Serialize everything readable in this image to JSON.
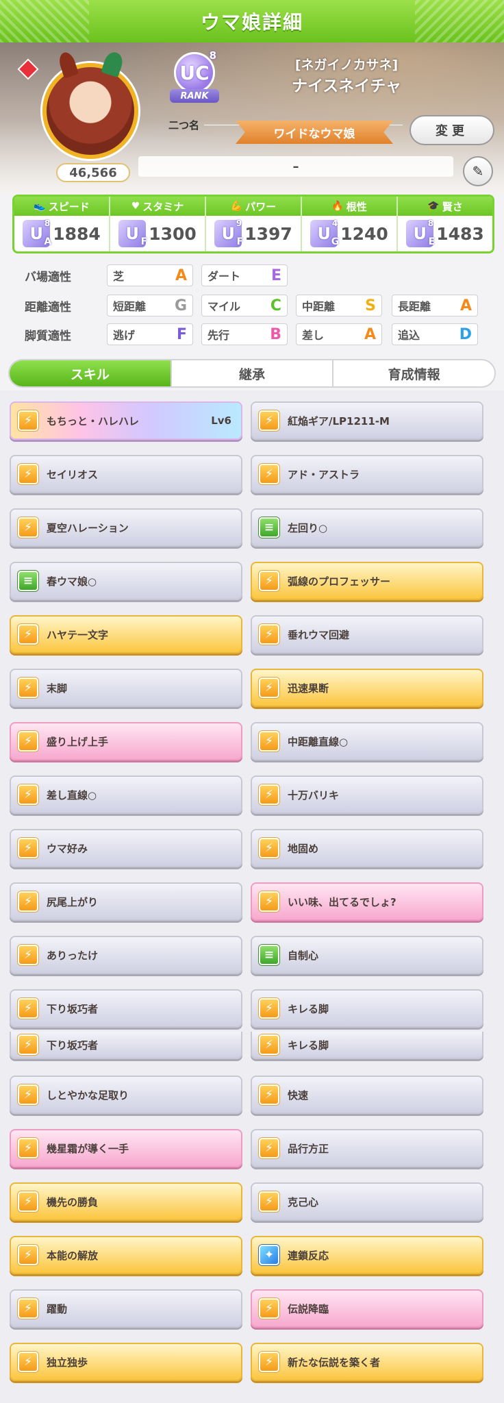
{
  "header": {
    "title": "ウマ娘詳細"
  },
  "profile": {
    "fans": "46,566",
    "rank": {
      "letter": "UC",
      "level": "8",
      "label": "RANK"
    },
    "nickname_label": "二つ名",
    "epithet": "[ネガイノカサネ]",
    "name": "ナイスネイチャ",
    "title_ribbon": "ワイドなウマ娘",
    "change_label": "変更",
    "memo": "–"
  },
  "stats": [
    {
      "label": "スピード",
      "icon": "shoe-icon",
      "grade": "U",
      "grade_sub": "A",
      "grade_sup": "8",
      "value": "1884"
    },
    {
      "label": "スタミナ",
      "icon": "heart-icon",
      "grade": "U",
      "grade_sub": "F",
      "grade_sup": "",
      "value": "1300"
    },
    {
      "label": "パワー",
      "icon": "muscle-icon",
      "grade": "U",
      "grade_sub": "F",
      "grade_sup": "9",
      "value": "1397"
    },
    {
      "label": "根性",
      "icon": "flame-icon",
      "grade": "U",
      "grade_sub": "G",
      "grade_sup": "4",
      "value": "1240"
    },
    {
      "label": "賢さ",
      "icon": "graduation-cap-icon",
      "grade": "U",
      "grade_sub": "E",
      "grade_sup": "8",
      "value": "1483"
    }
  ],
  "aptitudes": {
    "track": {
      "label": "バ場適性",
      "items": [
        {
          "name": "芝",
          "grade": "A"
        },
        {
          "name": "ダート",
          "grade": "E"
        }
      ]
    },
    "distance": {
      "label": "距離適性",
      "items": [
        {
          "name": "短距離",
          "grade": "G"
        },
        {
          "name": "マイル",
          "grade": "C"
        },
        {
          "name": "中距離",
          "grade": "S"
        },
        {
          "name": "長距離",
          "grade": "A"
        }
      ]
    },
    "style": {
      "label": "脚質適性",
      "items": [
        {
          "name": "逃げ",
          "grade": "F"
        },
        {
          "name": "先行",
          "grade": "B"
        },
        {
          "name": "差し",
          "grade": "A"
        },
        {
          "name": "追込",
          "grade": "D"
        }
      ]
    }
  },
  "grade_colors": {
    "A": "#f28a1c",
    "B": "#ec5aa8",
    "C": "#5ac12a",
    "D": "#2ea0e8",
    "E": "#a869e0",
    "F": "#7c5cd6",
    "G": "#9a9a9a",
    "S": "#f0b010"
  },
  "tabs": [
    "スキル",
    "継承",
    "育成情報"
  ],
  "skills": [
    {
      "name": "もちっと・ハレハレ",
      "lv": "Lv6",
      "style": "rainbow",
      "icon": "orange"
    },
    {
      "name": "紅焔ギア/LP1211-M",
      "lv": "",
      "style": "silver",
      "icon": "orange"
    },
    {
      "name": "セイリオス",
      "lv": "",
      "style": "silver",
      "icon": "orange"
    },
    {
      "name": "アド・アストラ",
      "lv": "",
      "style": "silver",
      "icon": "orange"
    },
    {
      "name": "夏空ハレーション",
      "lv": "",
      "style": "silver",
      "icon": "orange"
    },
    {
      "name": "左回り○",
      "lv": "",
      "style": "silver",
      "icon": "green"
    },
    {
      "name": "春ウマ娘○",
      "lv": "",
      "style": "silver",
      "icon": "green"
    },
    {
      "name": "弧線のプロフェッサー",
      "lv": "",
      "style": "gold",
      "icon": "orange"
    },
    {
      "name": "ハヤテ一文字",
      "lv": "",
      "style": "gold",
      "icon": "orange"
    },
    {
      "name": "垂れウマ回避",
      "lv": "",
      "style": "silver",
      "icon": "orange"
    },
    {
      "name": "末脚",
      "lv": "",
      "style": "silver",
      "icon": "orange"
    },
    {
      "name": "迅速果断",
      "lv": "",
      "style": "gold",
      "icon": "orange"
    },
    {
      "name": "盛り上げ上手",
      "lv": "",
      "style": "pink",
      "icon": "orange"
    },
    {
      "name": "中距離直線○",
      "lv": "",
      "style": "silver",
      "icon": "orange"
    },
    {
      "name": "差し直線○",
      "lv": "",
      "style": "silver",
      "icon": "orange"
    },
    {
      "name": "十万バリキ",
      "lv": "",
      "style": "silver",
      "icon": "orange"
    },
    {
      "name": "ウマ好み",
      "lv": "",
      "style": "silver",
      "icon": "orange"
    },
    {
      "name": "地固め",
      "lv": "",
      "style": "silver",
      "icon": "orange"
    },
    {
      "name": "尻尾上がり",
      "lv": "",
      "style": "silver",
      "icon": "orange"
    },
    {
      "name": "いい味、出てるでしょ?",
      "lv": "",
      "style": "pink",
      "icon": "orange"
    },
    {
      "name": "ありったけ",
      "lv": "",
      "style": "silver",
      "icon": "orange"
    },
    {
      "name": "自制心",
      "lv": "",
      "style": "silver",
      "icon": "green"
    },
    {
      "name": "下り坂巧者",
      "lv": "",
      "style": "silver",
      "icon": "orange"
    },
    {
      "name": "キレる脚",
      "lv": "",
      "style": "silver",
      "icon": "orange"
    },
    {
      "name": "下り坂巧者",
      "lv": "",
      "style": "silver",
      "icon": "orange",
      "cut": true
    },
    {
      "name": "キレる脚",
      "lv": "",
      "style": "silver",
      "icon": "orange",
      "cut": true
    },
    {
      "name": "しとやかな足取り",
      "lv": "",
      "style": "silver",
      "icon": "orange"
    },
    {
      "name": "快速",
      "lv": "",
      "style": "silver",
      "icon": "orange"
    },
    {
      "name": "幾星霜が導く一手",
      "lv": "",
      "style": "pink",
      "icon": "orange"
    },
    {
      "name": "品行方正",
      "lv": "",
      "style": "silver",
      "icon": "orange"
    },
    {
      "name": "機先の勝負",
      "lv": "",
      "style": "gold",
      "icon": "orange"
    },
    {
      "name": "克己心",
      "lv": "",
      "style": "silver",
      "icon": "orange"
    },
    {
      "name": "本能の解放",
      "lv": "",
      "style": "gold",
      "icon": "orange"
    },
    {
      "name": "連鎖反応",
      "lv": "",
      "style": "gold",
      "icon": "blue"
    },
    {
      "name": "躍動",
      "lv": "",
      "style": "silver",
      "icon": "orange"
    },
    {
      "name": "伝説降臨",
      "lv": "",
      "style": "pink",
      "icon": "orange"
    },
    {
      "name": "独立独歩",
      "lv": "",
      "style": "gold",
      "icon": "orange"
    },
    {
      "name": "新たな伝説を築く者",
      "lv": "",
      "style": "gold",
      "icon": "orange"
    }
  ]
}
